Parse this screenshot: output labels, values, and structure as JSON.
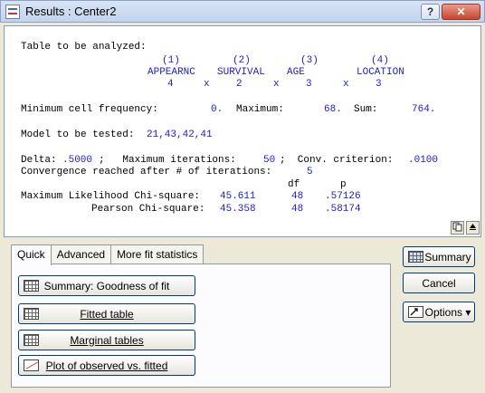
{
  "window": {
    "title": "Results : Center2",
    "help_label": "?",
    "close_label": "✕"
  },
  "results": {
    "table_header": "Table to be analyzed:",
    "factors": [
      {
        "index": "(1)",
        "name": "APPEARNC",
        "levels": "4"
      },
      {
        "index": "(2)",
        "name": "SURVIVAL",
        "levels": "2"
      },
      {
        "index": "(3)",
        "name": "AGE",
        "levels": "3"
      },
      {
        "index": "(4)",
        "name": "LOCATION",
        "levels": "3"
      }
    ],
    "times_symbol": "x",
    "min_cell_label": "Minimum cell frequency:",
    "min_cell_value": "0.",
    "max_label": "Maximum:",
    "max_value": "68.",
    "sum_label": "Sum:",
    "sum_value": "764.",
    "model_label": "Model to be tested:",
    "model_value": "21,43,42,41",
    "delta_label": "Delta:",
    "delta_value": ".5000",
    "max_iter_label": ";   Maximum iterations:",
    "max_iter_value": "50",
    "conv_label": ";  Conv. criterion:",
    "conv_value": ".0100",
    "converge_label": "Convergence reached after # of iterations:",
    "converge_value": "5",
    "col_df": "df",
    "col_p": "p",
    "ml_label": "Maximum Likelihood Chi-square:",
    "ml_chi": "45.611",
    "ml_df": "48",
    "ml_p": ".57126",
    "pearson_label": "Pearson Chi-square:",
    "pearson_chi": "45.358",
    "pearson_df": "48",
    "pearson_p": ".58174"
  },
  "tabs": [
    {
      "label": "Quick",
      "active": true
    },
    {
      "label": "Advanced",
      "active": false
    },
    {
      "label": "More fit statistics",
      "active": false
    }
  ],
  "quick": {
    "summary_goodness": "Summary:  Goodness of fit",
    "fitted_table": "Fitted table",
    "marginal_tables": "Marginal tables",
    "plot_observed": "Plot of observed vs. fitted"
  },
  "side": {
    "summary": "Summary",
    "cancel": "Cancel",
    "options": "Options ▾"
  }
}
